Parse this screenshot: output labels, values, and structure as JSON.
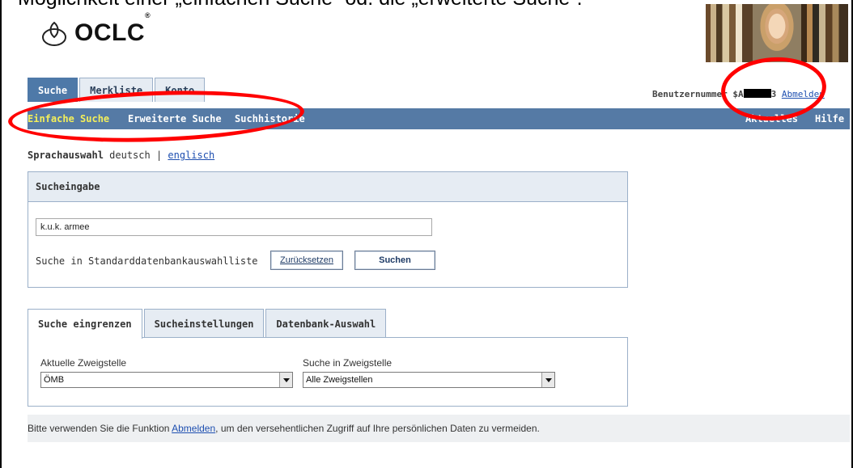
{
  "caption": "Möglichkeit einer „einfachen Suche“ od. die „erweiterte Suche“.",
  "logo": {
    "text": "OCLC",
    "tm": "®"
  },
  "top_tabs": [
    {
      "label": "Suche"
    },
    {
      "label": "Merkliste"
    },
    {
      "label": "Konto"
    }
  ],
  "user": {
    "prefix": "Benutzernummer $A",
    "suffix": "3 ",
    "logout_label": "Abmelden"
  },
  "navbar": {
    "items": [
      {
        "label": "Einfache Suche"
      },
      {
        "label": "Erweiterte Suche"
      },
      {
        "label": "Suchhistorie"
      },
      {
        "label": "Aktuelles"
      },
      {
        "label": "Hilfe"
      }
    ]
  },
  "language": {
    "label": "Sprachauswahl",
    "current": " deutsch ",
    "separator": "| ",
    "other": "englisch"
  },
  "search": {
    "heading": "Sucheingabe",
    "query": "k.u.k. armee",
    "scope_label": "Suche in Standarddatenbankauswahlliste",
    "reset_label": "Zurücksetzen",
    "submit_label": "Suchen"
  },
  "filter_tabs": [
    {
      "label": "Suche eingrenzen"
    },
    {
      "label": "Sucheinstellungen"
    },
    {
      "label": "Datenbank-Auswahl"
    }
  ],
  "filter": {
    "branch_label": "Aktuelle Zweigstelle",
    "branch_value": "ÖMB",
    "scope_label": "Suche in Zweigstelle",
    "scope_value": "Alle Zweigstellen"
  },
  "footer": {
    "before": "Bitte verwenden Sie die Funktion ",
    "link": "Abmelden",
    "after": ", um den versehentlichen Zugriff auf Ihre persönlichen Daten zu vermeiden."
  },
  "colors": {
    "nav_bar": "#557aa5",
    "active_nav": "#f4ef5a",
    "annotation_ring": "#ff0000",
    "link": "#1e4fb0"
  },
  "icons": [
    "oclc-logo-icon",
    "dropdown-arrow-icon"
  ]
}
